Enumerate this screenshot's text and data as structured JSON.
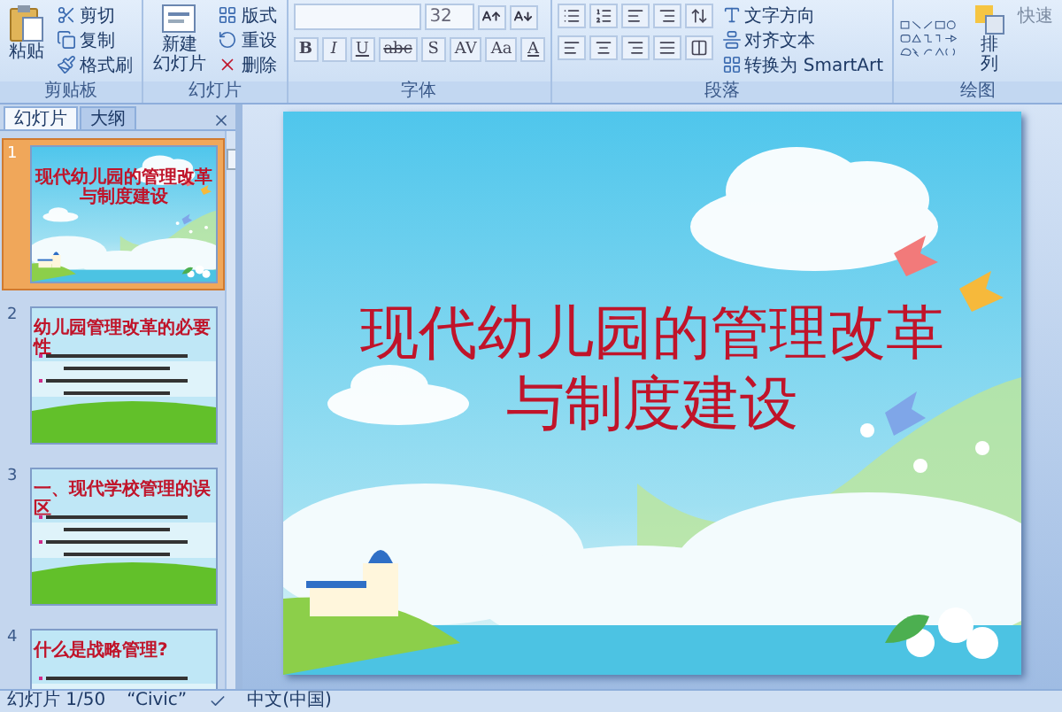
{
  "ribbon": {
    "clipboard": {
      "label": "剪贴板",
      "paste": "粘贴",
      "items": [
        "剪切",
        "复制",
        "格式刷"
      ]
    },
    "slides": {
      "label": "幻灯片",
      "new_slide": [
        "新建",
        "幻灯片"
      ],
      "items": [
        "版式",
        "重设",
        "删除"
      ]
    },
    "font": {
      "label": "字体",
      "font_size": "32",
      "format_buttons": [
        "B",
        "I",
        "U",
        "abc",
        "S",
        "AV",
        "Aa",
        "A"
      ]
    },
    "paragraph": {
      "label": "段落",
      "items": [
        "文字方向",
        "对齐文本",
        "转换为 SmartArt"
      ]
    },
    "drawing": {
      "label": "绘图",
      "arrange": "排列",
      "quick": "快速"
    }
  },
  "panel_tabs": [
    {
      "label": "幻灯片",
      "selected": true
    },
    {
      "label": "大纲",
      "selected": false
    }
  ],
  "thumbnails": [
    {
      "number": "1",
      "kind": "title",
      "selected": true,
      "title_lines": [
        "现代幼儿园的管理改革",
        "与制度建设"
      ]
    },
    {
      "number": "2",
      "kind": "content",
      "selected": false,
      "title_lines": [
        "幼儿园管理改革的必要性"
      ]
    },
    {
      "number": "3",
      "kind": "content",
      "selected": false,
      "title_lines": [
        "一、现代学校管理的误区"
      ]
    },
    {
      "number": "4",
      "kind": "content",
      "selected": false,
      "title_lines": [
        "什么是战略管理?"
      ]
    }
  ],
  "slide": {
    "title_lines": [
      "现代幼儿园的管理改革",
      "与制度建设"
    ]
  },
  "status_bar": [
    "幻灯片 1/50",
    "“Civic”",
    "中文(中国)"
  ]
}
